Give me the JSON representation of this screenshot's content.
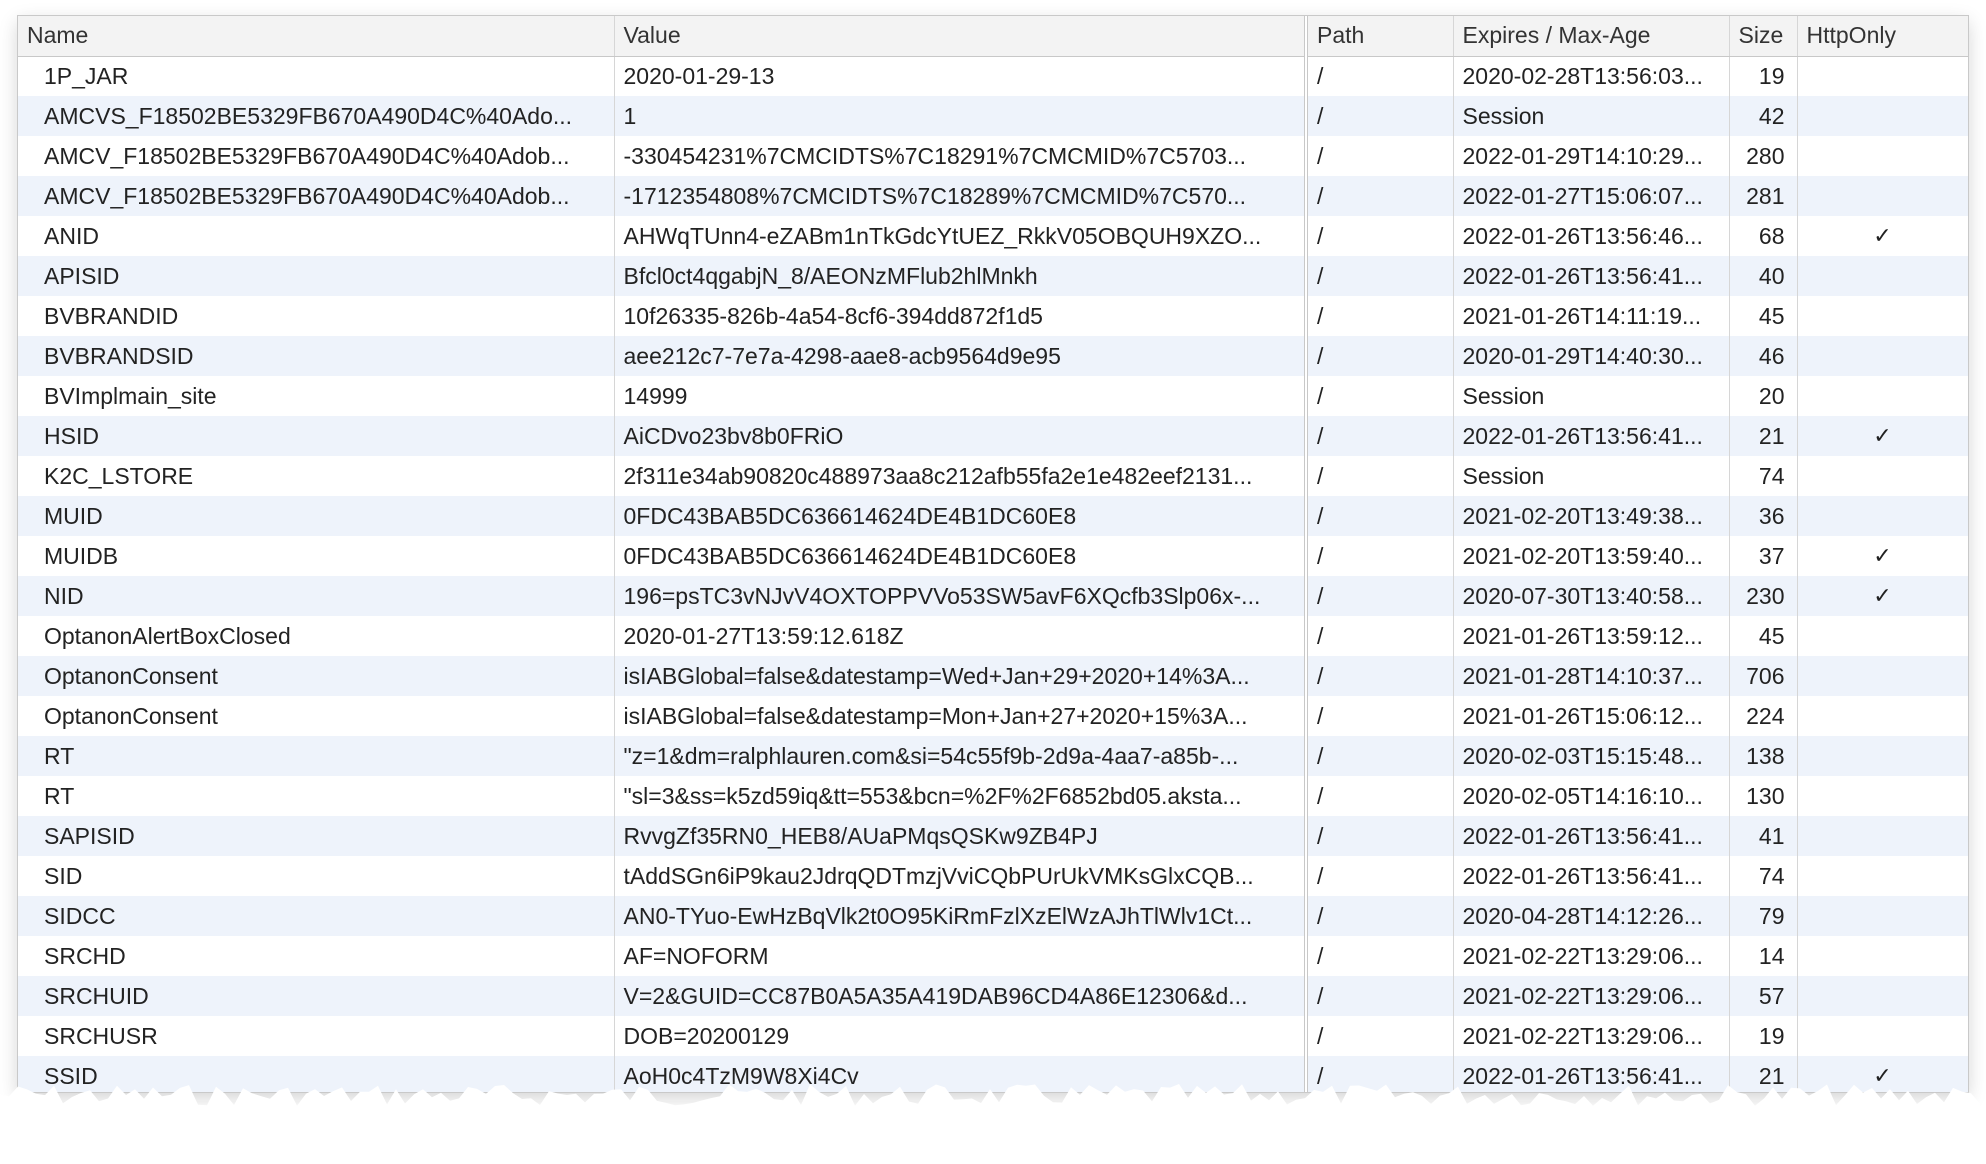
{
  "columns": {
    "name": "Name",
    "value": "Value",
    "path": "Path",
    "expires": "Expires / Max-Age",
    "size": "Size",
    "httponly": "HttpOnly"
  },
  "rows": [
    {
      "name": "1P_JAR",
      "value": "2020-01-29-13",
      "path": "/",
      "expires": "2020-02-28T13:56:03...",
      "size": "19",
      "httponly": ""
    },
    {
      "name": "AMCVS_F18502BE5329FB670A490D4C%40Ado...",
      "value": "1",
      "path": "/",
      "expires": "Session",
      "size": "42",
      "httponly": ""
    },
    {
      "name": "AMCV_F18502BE5329FB670A490D4C%40Adob...",
      "value": "-330454231%7CMCIDTS%7C18291%7CMCMID%7C5703...",
      "path": "/",
      "expires": "2022-01-29T14:10:29...",
      "size": "280",
      "httponly": ""
    },
    {
      "name": "AMCV_F18502BE5329FB670A490D4C%40Adob...",
      "value": "-1712354808%7CMCIDTS%7C18289%7CMCMID%7C570...",
      "path": "/",
      "expires": "2022-01-27T15:06:07...",
      "size": "281",
      "httponly": ""
    },
    {
      "name": "ANID",
      "value": "AHWqTUnn4-eZABm1nTkGdcYtUEZ_RkkV05OBQUH9XZO...",
      "path": "/",
      "expires": "2022-01-26T13:56:46...",
      "size": "68",
      "httponly": "✓"
    },
    {
      "name": "APISID",
      "value": "Bfcl0ct4qgabjN_8/AEONzMFlub2hlMnkh",
      "path": "/",
      "expires": "2022-01-26T13:56:41...",
      "size": "40",
      "httponly": ""
    },
    {
      "name": "BVBRANDID",
      "value": "10f26335-826b-4a54-8cf6-394dd872f1d5",
      "path": "/",
      "expires": "2021-01-26T14:11:19...",
      "size": "45",
      "httponly": ""
    },
    {
      "name": "BVBRANDSID",
      "value": "aee212c7-7e7a-4298-aae8-acb9564d9e95",
      "path": "/",
      "expires": "2020-01-29T14:40:30...",
      "size": "46",
      "httponly": ""
    },
    {
      "name": "BVImplmain_site",
      "value": "14999",
      "path": "/",
      "expires": "Session",
      "size": "20",
      "httponly": ""
    },
    {
      "name": "HSID",
      "value": "AiCDvo23bv8b0FRiO",
      "path": "/",
      "expires": "2022-01-26T13:56:41...",
      "size": "21",
      "httponly": "✓"
    },
    {
      "name": "K2C_LSTORE",
      "value": "2f311e34ab90820c488973aa8c212afb55fa2e1e482eef2131...",
      "path": "/",
      "expires": "Session",
      "size": "74",
      "httponly": ""
    },
    {
      "name": "MUID",
      "value": "0FDC43BAB5DC636614624DE4B1DC60E8",
      "path": "/",
      "expires": "2021-02-20T13:49:38...",
      "size": "36",
      "httponly": ""
    },
    {
      "name": "MUIDB",
      "value": "0FDC43BAB5DC636614624DE4B1DC60E8",
      "path": "/",
      "expires": "2021-02-20T13:59:40...",
      "size": "37",
      "httponly": "✓"
    },
    {
      "name": "NID",
      "value": "196=psTC3vNJvV4OXTOPPVVo53SW5avF6XQcfb3Slp06x-...",
      "path": "/",
      "expires": "2020-07-30T13:40:58...",
      "size": "230",
      "httponly": "✓"
    },
    {
      "name": "OptanonAlertBoxClosed",
      "value": "2020-01-27T13:59:12.618Z",
      "path": "/",
      "expires": "2021-01-26T13:59:12...",
      "size": "45",
      "httponly": ""
    },
    {
      "name": "OptanonConsent",
      "value": "isIABGlobal=false&datestamp=Wed+Jan+29+2020+14%3A...",
      "path": "/",
      "expires": "2021-01-28T14:10:37...",
      "size": "706",
      "httponly": ""
    },
    {
      "name": "OptanonConsent",
      "value": "isIABGlobal=false&datestamp=Mon+Jan+27+2020+15%3A...",
      "path": "/",
      "expires": "2021-01-26T15:06:12...",
      "size": "224",
      "httponly": ""
    },
    {
      "name": "RT",
      "value": "\"z=1&dm=ralphlauren.com&si=54c55f9b-2d9a-4aa7-a85b-...",
      "path": "/",
      "expires": "2020-02-03T15:15:48...",
      "size": "138",
      "httponly": ""
    },
    {
      "name": "RT",
      "value": "\"sl=3&ss=k5zd59iq&tt=553&bcn=%2F%2F6852bd05.aksta...",
      "path": "/",
      "expires": "2020-02-05T14:16:10...",
      "size": "130",
      "httponly": ""
    },
    {
      "name": "SAPISID",
      "value": "RvvgZf35RN0_HEB8/AUaPMqsQSKw9ZB4PJ",
      "path": "/",
      "expires": "2022-01-26T13:56:41...",
      "size": "41",
      "httponly": ""
    },
    {
      "name": "SID",
      "value": "tAddSGn6iP9kau2JdrqQDTmzjVviCQbPUrUkVMKsGlxCQB...",
      "path": "/",
      "expires": "2022-01-26T13:56:41...",
      "size": "74",
      "httponly": ""
    },
    {
      "name": "SIDCC",
      "value": "AN0-TYuo-EwHzBqVlk2t0O95KiRmFzlXzElWzAJhTlWlv1Ct...",
      "path": "/",
      "expires": "2020-04-28T14:12:26...",
      "size": "79",
      "httponly": ""
    },
    {
      "name": "SRCHD",
      "value": "AF=NOFORM",
      "path": "/",
      "expires": "2021-02-22T13:29:06...",
      "size": "14",
      "httponly": ""
    },
    {
      "name": "SRCHUID",
      "value": "V=2&GUID=CC87B0A5A35A419DAB96CD4A86E12306&d...",
      "path": "/",
      "expires": "2021-02-22T13:29:06...",
      "size": "57",
      "httponly": ""
    },
    {
      "name": "SRCHUSR",
      "value": "DOB=20200129",
      "path": "/",
      "expires": "2021-02-22T13:29:06...",
      "size": "19",
      "httponly": ""
    },
    {
      "name": "SSID",
      "value": "AoH0c4TzM9W8Xi4Cv",
      "path": "/",
      "expires": "2022-01-26T13:56:41...",
      "size": "21",
      "httponly": "✓"
    }
  ]
}
